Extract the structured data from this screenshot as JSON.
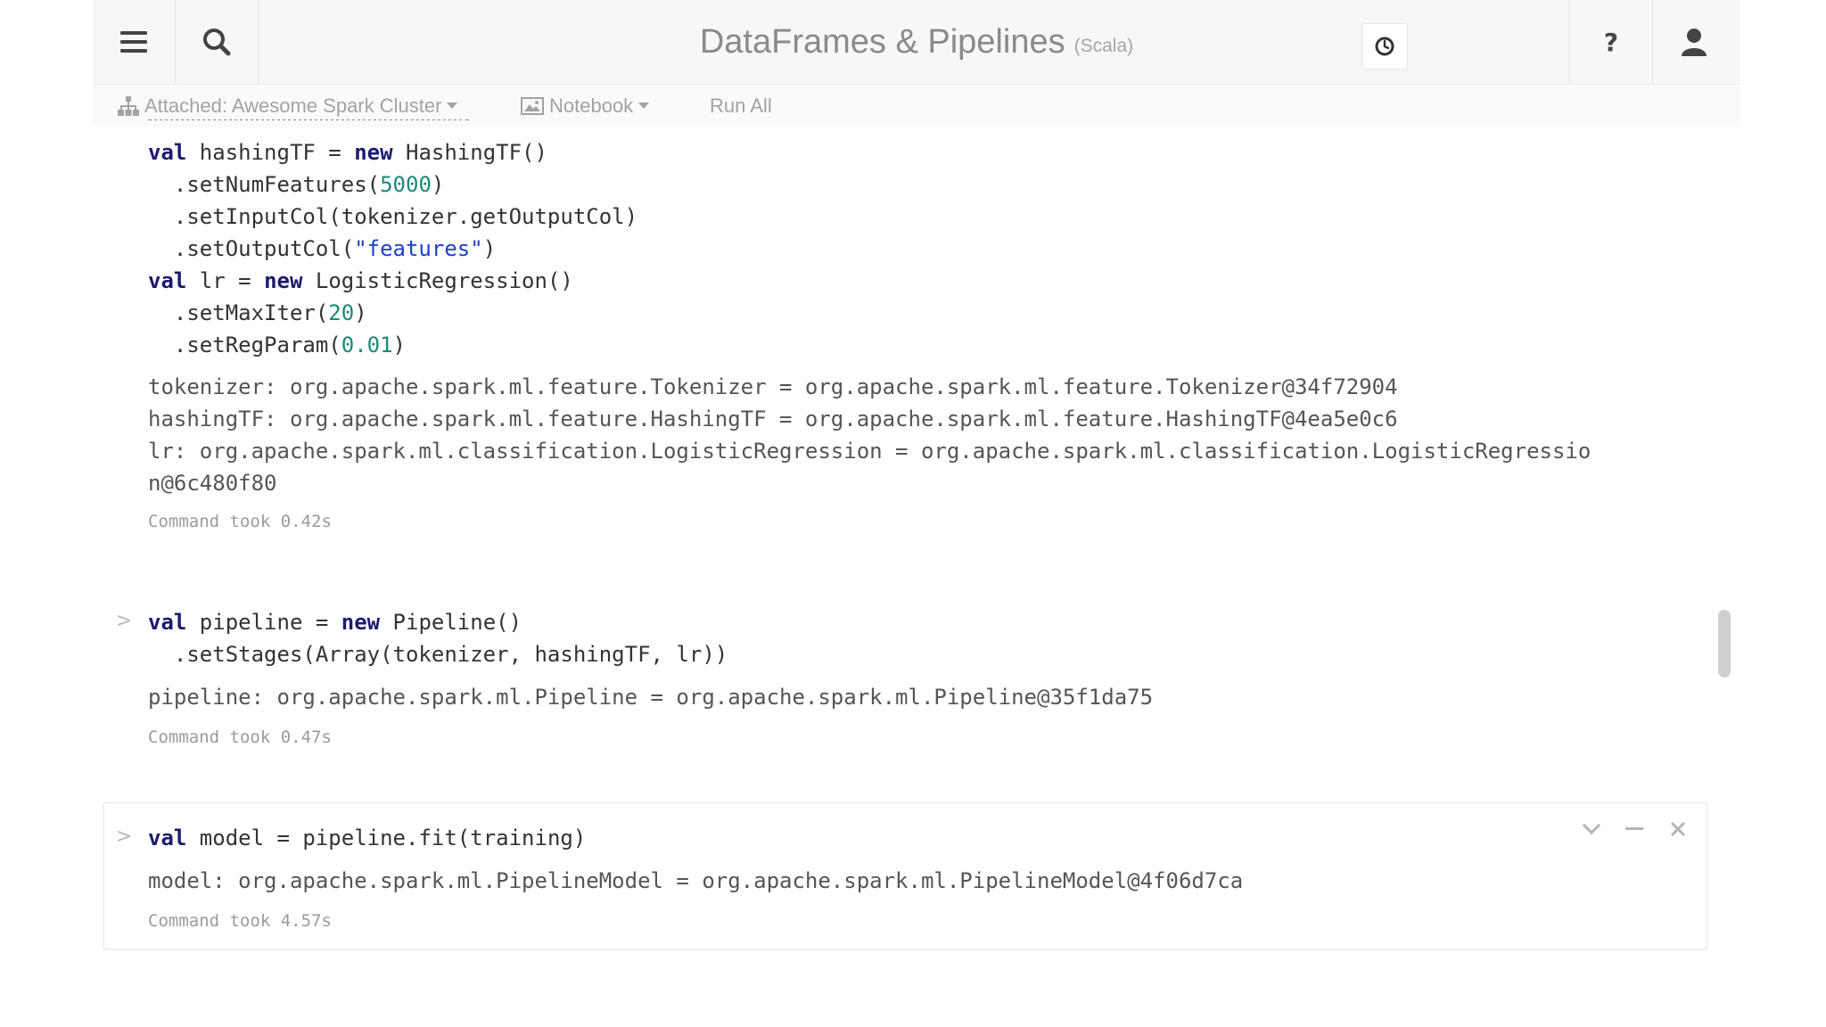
{
  "header": {
    "title": "DataFrames & Pipelines",
    "language": "(Scala)"
  },
  "icons": {
    "menu": "menu-icon",
    "search": "search-icon",
    "clock": "clock-icon",
    "help": "help-icon",
    "user": "user-icon"
  },
  "toolbar": {
    "cluster_label": "Attached: Awesome Spark Cluster",
    "notebook_label": "Notebook",
    "run_all_label": "Run All"
  },
  "cells": [
    {
      "code": [
        [
          {
            "t": "val",
            "c": "kw"
          },
          {
            "t": " hashingTF = "
          },
          {
            "t": "new",
            "c": "kw"
          },
          {
            "t": " HashingTF()"
          }
        ],
        [
          {
            "t": "  .setNumFeatures("
          },
          {
            "t": "5000",
            "c": "num"
          },
          {
            "t": ")"
          }
        ],
        [
          {
            "t": "  .setInputCol(tokenizer.getOutputCol)"
          }
        ],
        [
          {
            "t": "  .setOutputCol("
          },
          {
            "t": "\"features\"",
            "c": "str"
          },
          {
            "t": ")"
          }
        ],
        [
          {
            "t": "val",
            "c": "kw"
          },
          {
            "t": " lr = "
          },
          {
            "t": "new",
            "c": "kw"
          },
          {
            "t": " LogisticRegression()"
          }
        ],
        [
          {
            "t": "  .setMaxIter("
          },
          {
            "t": "20",
            "c": "num"
          },
          {
            "t": ")"
          }
        ],
        [
          {
            "t": "  .setRegParam("
          },
          {
            "t": "0.01",
            "c": "num"
          },
          {
            "t": ")"
          }
        ]
      ],
      "output": [
        "tokenizer: org.apache.spark.ml.feature.Tokenizer = org.apache.spark.ml.feature.Tokenizer@34f72904",
        "hashingTF: org.apache.spark.ml.feature.HashingTF = org.apache.spark.ml.feature.HashingTF@4ea5e0c6",
        "lr: org.apache.spark.ml.classification.LogisticRegression = org.apache.spark.ml.classification.LogisticRegressio",
        "n@6c480f80"
      ],
      "took": "Command took 0.42s"
    },
    {
      "code": [
        [
          {
            "t": "val",
            "c": "kw"
          },
          {
            "t": " pipeline = "
          },
          {
            "t": "new",
            "c": "kw"
          },
          {
            "t": " Pipeline()"
          }
        ],
        [
          {
            "t": "  .setStages(Array(tokenizer, hashingTF, lr))"
          }
        ]
      ],
      "output": [
        "pipeline: org.apache.spark.ml.Pipeline = org.apache.spark.ml.Pipeline@35f1da75"
      ],
      "took": "Command took 0.47s"
    },
    {
      "code": [
        [
          {
            "t": "val",
            "c": "kw"
          },
          {
            "t": " model = pipeline.fit(training)"
          }
        ]
      ],
      "output": [
        "model: org.apache.spark.ml.PipelineModel = org.apache.spark.ml.PipelineModel@4f06d7ca"
      ],
      "took": "Command took 4.57s"
    }
  ]
}
